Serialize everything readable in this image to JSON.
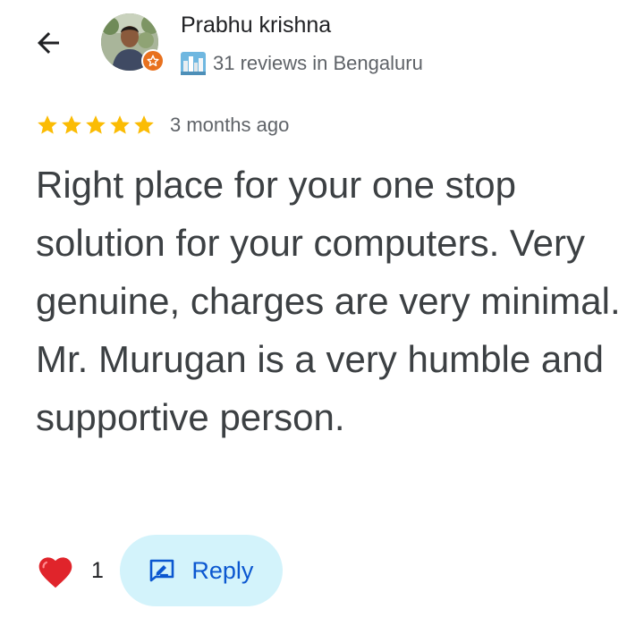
{
  "reviewer": {
    "name": "Prabhu krishna",
    "review_summary": "31 reviews in Bengaluru",
    "badge_icon": "local-guide-star-icon",
    "badge_color": "#e8711e"
  },
  "review": {
    "rating": 5,
    "rating_max": 5,
    "date": "3 months ago",
    "text": "Right place for your one stop solution for your computers. Very genuine, charges are very minimal. Mr. Murugan is a very humble and supportive person.",
    "star_color": "#fbbc04"
  },
  "actions": {
    "like_icon": "heart-icon",
    "like_count": "1",
    "reply_icon": "reply-icon",
    "reply_label": "Reply",
    "reply_bg": "#d3f3fb",
    "reply_text_color": "#0b57d0"
  },
  "navigation": {
    "back_icon": "back-arrow-icon"
  }
}
